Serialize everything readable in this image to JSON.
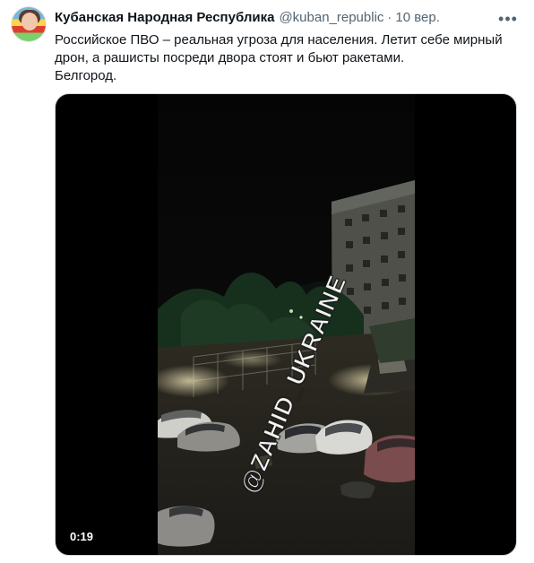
{
  "tweet": {
    "author_name": "Кубанская Народная Республика",
    "handle": "@kuban_republic",
    "separator": "·",
    "timestamp": "10 вер.",
    "more_icon": "more-icon",
    "text_lines": [
      "Российское ПВО – реальная угроза для населения. Летит себе мирный",
      "дрон, а рашисты посреди двора стоят и бьют ракетами.",
      "Белгород."
    ],
    "media": {
      "video_duration": "0:19",
      "watermark": "@ZAHID_UKRAINE"
    }
  },
  "colors": {
    "text_primary": "#0f1419",
    "text_secondary": "#536471",
    "media_border": "#cfd9de",
    "background": "#ffffff"
  }
}
